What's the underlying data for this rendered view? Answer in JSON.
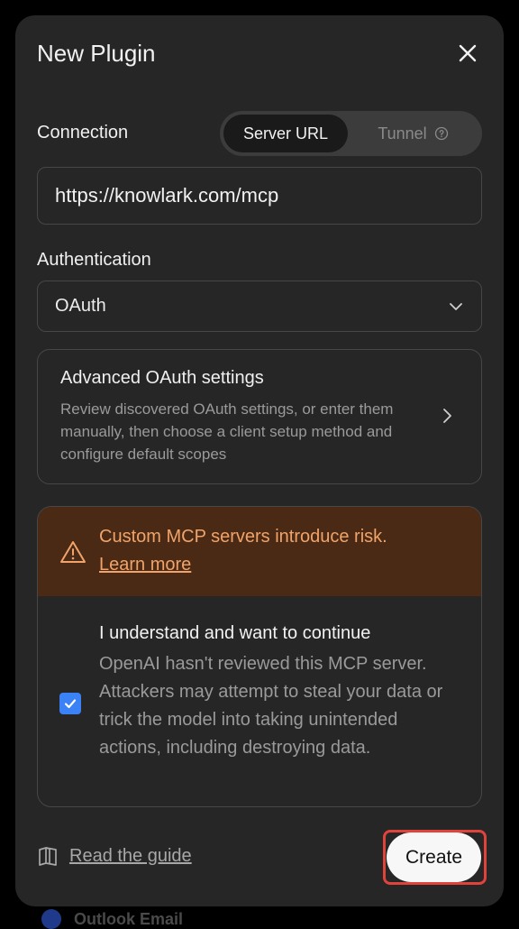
{
  "modal": {
    "title": "New Plugin",
    "close_icon": "close-icon"
  },
  "connection": {
    "label": "Connection",
    "options": [
      "Server URL",
      "Tunnel"
    ],
    "selected": "Server URL",
    "tunnel_help_icon": "question-circle-icon",
    "url_value": "https://knowlark.com/mcp"
  },
  "authentication": {
    "label": "Authentication",
    "selected": "OAuth",
    "dropdown_icon": "chevron-down-icon"
  },
  "advanced": {
    "title": "Advanced OAuth settings",
    "description": "Review discovered OAuth settings, or enter them manually, then choose a client setup method and configure default scopes",
    "chevron_icon": "chevron-right-icon"
  },
  "risk": {
    "warning_icon": "warning-triangle-icon",
    "title": "Custom MCP servers introduce risk.",
    "link": "Learn more",
    "consent_title": "I understand and want to continue",
    "consent_description": "OpenAI hasn't reviewed this MCP server. Attackers may attempt to steal your data or trick the model into taking unintended actions, including destroying data.",
    "checked": true
  },
  "footer": {
    "guide_icon": "book-icon",
    "guide_label": "Read the guide",
    "create_label": "Create"
  },
  "backdrop": {
    "item_label": "Outlook Email"
  },
  "colors": {
    "modal_bg": "#262626",
    "warning_bg": "#4a2a14",
    "warning_text": "#f0a36a",
    "checkbox": "#3b82f6",
    "highlight": "#e0433b"
  }
}
